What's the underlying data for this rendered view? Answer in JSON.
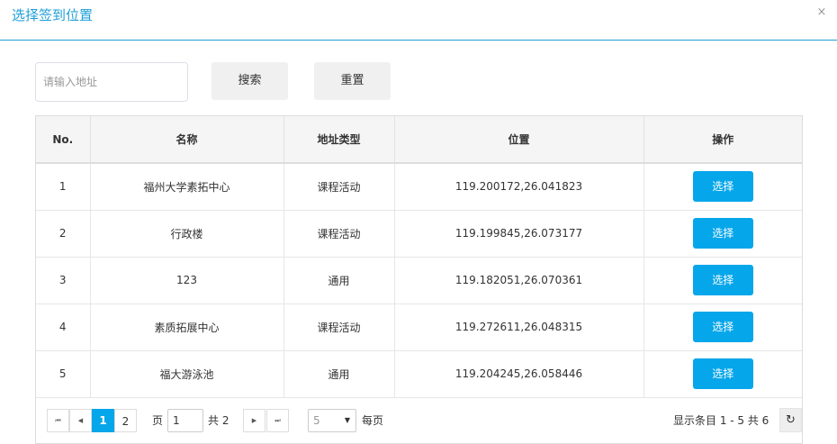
{
  "dialog": {
    "title": "选择签到位置",
    "close_glyph": "×",
    "close_icon": "close-icon"
  },
  "search": {
    "placeholder": "请输入地址",
    "value": "",
    "search_label": "搜索",
    "reset_label": "重置"
  },
  "table": {
    "headers": {
      "no": "No.",
      "name": "名称",
      "type": "地址类型",
      "location": "位置",
      "action": "操作"
    },
    "rows": [
      {
        "no": "1",
        "name": "福州大学素拓中心",
        "type": "课程活动",
        "location": "119.200172,26.041823",
        "action": "选择"
      },
      {
        "no": "2",
        "name": "行政楼",
        "type": "课程活动",
        "location": "119.199845,26.073177",
        "action": "选择"
      },
      {
        "no": "3",
        "name": "123",
        "type": "通用",
        "location": "119.182051,26.070361",
        "action": "选择"
      },
      {
        "no": "4",
        "name": "素质拓展中心",
        "type": "课程活动",
        "location": "119.272611,26.048315",
        "action": "选择"
      },
      {
        "no": "5",
        "name": "福大游泳池",
        "type": "通用",
        "location": "119.204245,26.058446",
        "action": "选择"
      }
    ]
  },
  "pagination": {
    "first_glyph": "⏮",
    "prev_glyph": "◀",
    "next_glyph": "▶",
    "last_glyph": "⏭",
    "pages": [
      "1",
      "2"
    ],
    "current_page": "1",
    "page_label": "页",
    "page_input_value": "1",
    "total_pages_label": "共 2",
    "page_size": "5",
    "page_size_caret": "▼",
    "per_page_label": "每页",
    "info": "显示条目 1 - 5 共 6",
    "refresh_glyph": "↻",
    "refresh_icon": "refresh-icon"
  },
  "colors": {
    "accent": "#1e9fd6",
    "button_primary": "#06a6ea",
    "header_bg": "#f5f5f5"
  }
}
